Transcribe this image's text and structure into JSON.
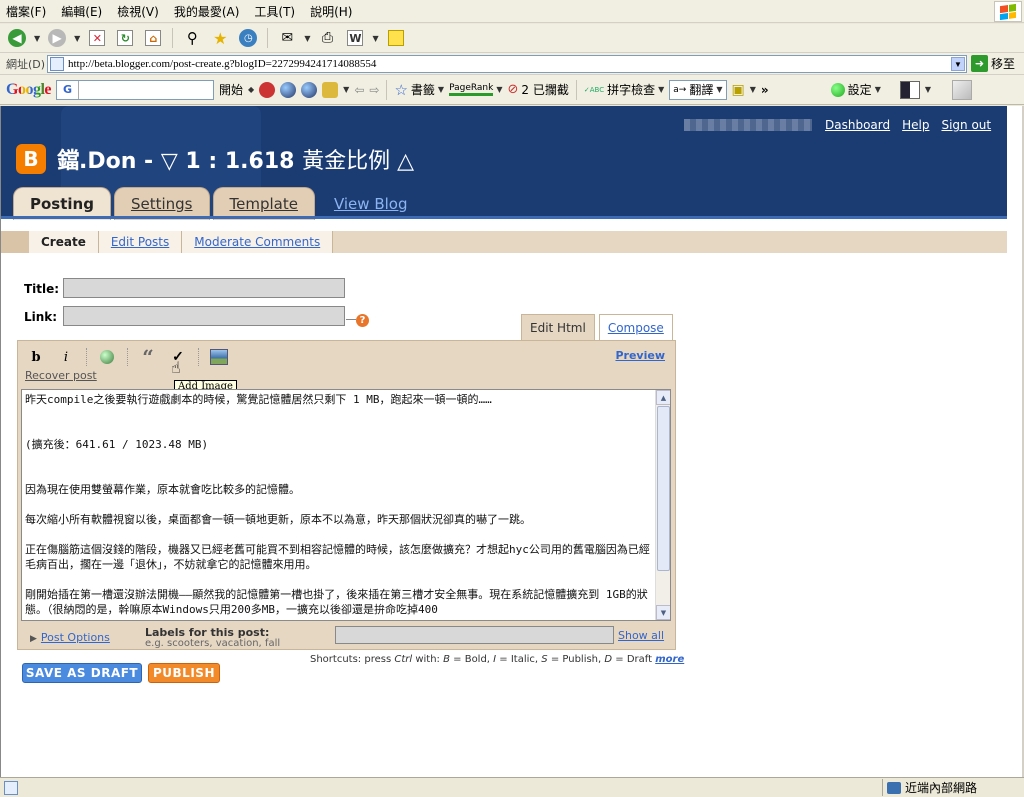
{
  "menu": [
    "檔案(F)",
    "編輯(E)",
    "檢視(V)",
    "我的最愛(A)",
    "工具(T)",
    "說明(H)"
  ],
  "address": {
    "label": "網址(D)",
    "url": "http://beta.blogger.com/post-create.g?blogID=2272994241714088554",
    "go_label": "移至"
  },
  "gtoolbar": {
    "logo": "Google",
    "search_prefix": "G",
    "start_label": "開始",
    "bookmarks": "書籤",
    "pagerank": "PageRank",
    "blocked": "2 已攔截",
    "abc_icon_text": "ABC",
    "spellcheck": "拼字檢查",
    "translate_glyph": "a→",
    "translate": "翻譯",
    "more": "»",
    "settings": "設定"
  },
  "blogger": {
    "nav_links": [
      "Dashboard",
      "Help",
      "Sign out"
    ],
    "badge": "B",
    "title_main": "鐺.Don - ▽ 1 : 1.618 ",
    "title_tail": "黃金比例 △",
    "tabs": [
      "Posting",
      "Settings",
      "Template",
      "View Blog"
    ],
    "subnav": [
      "Create",
      "Edit Posts",
      "Moderate Comments"
    ]
  },
  "form": {
    "title_label": "Title:",
    "link_label": "Link:",
    "help_glyph": "?",
    "mode_tabs": [
      "Edit Html",
      "Compose"
    ],
    "toolbar": [
      "b",
      "i",
      "“",
      "✓"
    ],
    "recover": "Recover post",
    "tooltip": "Add Image",
    "preview": "Preview",
    "body": "昨天compile之後要執行遊戲劇本的時候，驚覺記憶體居然只剩下 1 MB，跑起來一頓一頓的……\n\n\n(擴充後：641.61 / 1023.48 MB)\n\n\n因為現在使用雙螢幕作業，原本就會吃比較多的記憶體。\n\n每次縮小所有軟體視窗以後，桌面都會一頓一頓地更新，原本不以為意，昨天那個狀況卻真的嚇了一跳。\n\n正在傷腦筋這個沒錢的階段，機器又已經老舊可能買不到相容記憶體的時候，該怎麼做擴充？才想起hyc公司用的舊電腦因為已經毛病百出，擱在一邊「退休」，不妨就拿它的記憶體來用用。\n\n剛開始插在第一槽還沒辦法開機——顯然我的記憶體第一槽也掛了，後來插在第三槽才安全無事。現在系統記憶體擴充到 1GB的狀態。（很納悶的是，幹嘛原本Windows只用200多MB，一擴充以後卻還是拚命吃掉400",
    "post_options": "Post Options",
    "labels_title": "Labels for this post:",
    "labels_hint": "e.g. scooters, vacation, fall",
    "show_all": "Show all",
    "save_draft": "SAVE AS DRAFT",
    "publish": "PUBLISH",
    "shortcuts_prefix": "Shortcuts: press ",
    "shortcuts_ctrl": "Ctrl",
    "shortcuts_with": " with: ",
    "shortcuts_b": "B",
    "shortcuts_b_text": " = Bold, ",
    "shortcuts_i": "I",
    "shortcuts_i_text": " = Italic, ",
    "shortcuts_s": "S",
    "shortcuts_s_text": " = Publish, ",
    "shortcuts_d": "D",
    "shortcuts_d_text": " = Draft ",
    "shortcuts_more": "more"
  },
  "status": {
    "zone": "近端內部網路"
  },
  "colors": {
    "blogger_header": "#1b3c73",
    "accent_orange": "#f38a2a",
    "link": "#3366cc",
    "tan": "#e6d7c3"
  }
}
